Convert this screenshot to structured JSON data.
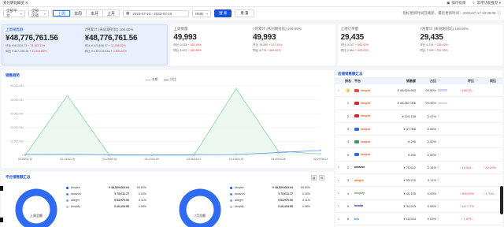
{
  "tabbar": {
    "tab_label": "支付转化概览 X",
    "right_items": [
      "操作指南",
      "常用功能推荐 ▾"
    ]
  },
  "filters": {
    "platform_select": "全部平台",
    "site_select": "全部店铺",
    "period_tabs": [
      "上周",
      "本周",
      "本月",
      "上月"
    ],
    "active_period": "上周",
    "date_range": "2023-07-10 - 2023-07-16",
    "currency": "RMB",
    "query_button": "搜 索",
    "reset_button": "重 置",
    "update_note": "指标更新时间在刷新，最近更新时间：2023-07-17 10:38:06"
  },
  "kpis": [
    {
      "label_left": "上周销售额",
      "value_left": "¥48,776,761.56",
      "rows_left": [
        {
          "k": "环比",
          "v": "¥ 41,520.73",
          "delta": "+ 79,103.11%",
          "dir": "up"
        },
        {
          "k": "同比",
          "v": "¥ 427,158.78",
          "delta": "+ 11,319.85%",
          "dir": "up"
        }
      ],
      "label_right": "7月累计 (未同期对比) 100.00%",
      "value_right": "¥48,776,761.56",
      "rows_right": [
        {
          "k": "环比",
          "v": "¥ 420,656.97",
          "delta": "+ 11,495.82%",
          "dir": "up"
        },
        {
          "k": "同比",
          "v": "¥ 1,873,115.63",
          "delta": "+ 2,503.21%",
          "dir": "up"
        }
      ],
      "active": true
    },
    {
      "label_left": "上周销量",
      "value_left": "49,993",
      "rows_left": [
        {
          "k": "环比",
          "v": "6,028",
          "delta": "+ 654.49%",
          "dir": "up"
        },
        {
          "k": "同比",
          "v": "4,621",
          "delta": "+ 981.86%",
          "dir": "up"
        }
      ],
      "label_right": "7月累计 (未同期对比) 100.00%",
      "value_right": "49,993",
      "rows_right": [
        {
          "k": "环比",
          "v": "14,090",
          "delta": "+ 247.41%",
          "dir": "up"
        },
        {
          "k": "同比",
          "v": "8,778",
          "delta": "+ 469.52%",
          "dir": "up"
        }
      ],
      "active": false
    },
    {
      "label_left": "上周订单量",
      "value_left": "29,435",
      "rows_left": [
        {
          "k": "环比",
          "v": "4,107",
          "delta": "+ 583.42%",
          "dir": "up"
        },
        {
          "k": "同比",
          "v": "2,664",
          "delta": "+ 999.93%",
          "dir": "up"
        }
      ],
      "label_right": "7月累计 (未同期对比) 100.00%",
      "value_right": "29,435",
      "rows_right": [
        {
          "k": "环比",
          "v": "8,744",
          "delta": "+ 236.63%",
          "dir": "up"
        },
        {
          "k": "同比",
          "v": "7,325",
          "delta": "+ 301.95%",
          "dir": "up"
        }
      ],
      "active": false
    }
  ],
  "trend_panel": {
    "title": "销售趋势",
    "legend": [
      "本期",
      "同比"
    ]
  },
  "chart_data": {
    "type": "line",
    "title": "销售趋势",
    "x": [
      "02-06/02-12",
      "02-13/02-19",
      "02-20/02-26",
      "03-27/03-05",
      "03-06/03-12",
      "03-13/03-19",
      "03-20/03-26",
      "03-27/04-02"
    ],
    "ylim": [
      0,
      50000000
    ],
    "yticks": [
      "0",
      "10,000,000",
      "20,000,000",
      "30,000,000",
      "40,000,000",
      "50,000,000"
    ],
    "series": [
      {
        "name": "本期",
        "color": "#8fd3a8",
        "values": [
          0,
          43000000,
          0,
          0,
          0,
          48000000,
          3000000,
          1000000
        ]
      },
      {
        "name": "同比",
        "color": "#5b8def",
        "values": [
          500000,
          600000,
          400000,
          300000,
          400000,
          500000,
          2000000,
          3500000
        ]
      }
    ]
  },
  "store_panel": {
    "title": "店铺销售额汇总",
    "columns": [
      "排名",
      "平台",
      "销售额",
      "占比",
      "环比",
      "同比"
    ],
    "rows": [
      {
        "exp": "▾",
        "rank": "1",
        "plat": "shopee",
        "flag": "#e94b3c",
        "logo_color": "#ee4d2d",
        "sales": "¥ 48,529,663",
        "share": "99.50%",
        "bar": 1.0,
        "mom": "↑ 136,03...",
        "yoy": ""
      },
      {
        "exp": "",
        "rank": "1",
        "plat": "shopee",
        "flag": "#d62828",
        "logo_color": "#ee4d2d",
        "sales": "¥ 48,267,006",
        "share": "99.46%",
        "bar": 0.99,
        "mom": "",
        "yoy": ""
      },
      {
        "exp": "",
        "rank": "2",
        "plat": "shopee",
        "flag": "#d62828",
        "logo_color": "#ee4d2d",
        "sales": "¥ 224,138",
        "share": "0.47%",
        "bar": 0.05,
        "mom": "",
        "yoy": ""
      },
      {
        "exp": "",
        "rank": "3",
        "plat": "shopee",
        "flag": "#2a6fdb",
        "logo_color": "#ee4d2d",
        "sales": "¥ 37,965",
        "share": "0.08%",
        "bar": 0.02,
        "mom": "",
        "yoy": ""
      },
      {
        "exp": "",
        "rank": "4",
        "plat": "shopee",
        "flag": "#2e9e4f",
        "logo_color": "#ee4d2d",
        "sales": "¥ 295",
        "share": "0.00%",
        "bar": 0.01,
        "mom": "",
        "yoy": ""
      },
      {
        "exp": "",
        "rank": "5",
        "plat": "shopee",
        "flag": "#2a6fdb",
        "logo_color": "#ee4d2d",
        "sales": "¥ 260",
        "share": "0.00%",
        "bar": 0.01,
        "mom": "",
        "yoy": ""
      },
      {
        "exp": "▸",
        "rank": "2",
        "plat": "amazon",
        "flag": "",
        "logo_color": "#222222",
        "sales": "¥ 75,612",
        "share": "0.16%",
        "bar": 0.03,
        "mom": "↑ 16,542...",
        "yoy": "↑ 82.20%"
      },
      {
        "exp": "▸",
        "rank": "3",
        "plat": "allegro",
        "flag": "",
        "logo_color": "#ff5a00",
        "sales": "¥ 53,970",
        "share": "0.11%",
        "bar": 0.02,
        "mom": "",
        "yoy": ""
      },
      {
        "exp": "▸",
        "rank": "4",
        "plat": "shopify",
        "flag": "",
        "logo_color": "#5e8e3e",
        "sales": "¥ 40,105",
        "share": "0.09%",
        "bar": 0.02,
        "mom": "↑ 359.59%",
        "yoy": "↑ 1,763..."
      },
      {
        "exp": "▸",
        "rank": "5",
        "plat": "lazada",
        "flag": "",
        "logo_color": "#1a237e",
        "sales": "¥ 34,213",
        "share": "0.08%",
        "bar": 0.02,
        "mom": "↑ 147.77%",
        "yoy": ""
      },
      {
        "exp": "▸",
        "rank": "6",
        "plat": "b2c",
        "flag": "",
        "logo_color": "#1677ff",
        "sales": "¥ 18,534",
        "share": "0.03%",
        "bar": 0.01,
        "mom": "↑ 1,675...",
        "yoy": ""
      }
    ]
  },
  "platform_panel": {
    "title": "平台销售额汇总",
    "donuts": [
      {
        "center": "上周总额",
        "rows": [
          {
            "name": "shopee",
            "color": "#1a4fd6",
            "value": "¥ 48,529,663.64",
            "pct": "99.50%"
          },
          {
            "name": "amazon",
            "color": "#4f86f7",
            "value": "¥ 75,611.77",
            "pct": "0.16%"
          },
          {
            "name": "allegro",
            "color": "#7aa5ff",
            "value": "¥ 53,970.06",
            "pct": "0.11%"
          },
          {
            "name": "shopify",
            "color": "#a9c3ff",
            "value": "¥ 40,104.85",
            "pct": "0.08%"
          }
        ]
      },
      {
        "center": "7月总额",
        "rows": [
          {
            "name": "shopee",
            "color": "#1a4fd6",
            "value": "¥ 48,529,663.64",
            "pct": "99.50%"
          },
          {
            "name": "amazon",
            "color": "#4f86f7",
            "value": "¥ 75,611.77",
            "pct": "0.16%"
          },
          {
            "name": "allegro",
            "color": "#7aa5ff",
            "value": "¥ 53,970.06",
            "pct": "0.11%"
          },
          {
            "name": "shopify",
            "color": "#a9c3ff",
            "value": "¥ 40,104.85",
            "pct": "0.08%"
          }
        ]
      }
    ]
  }
}
